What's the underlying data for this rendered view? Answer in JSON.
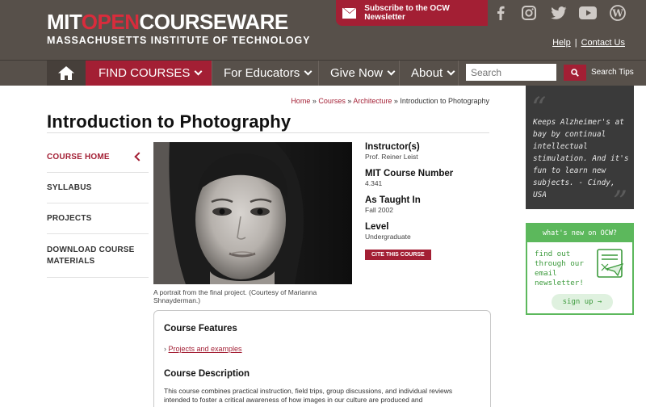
{
  "header": {
    "logo_part1": "MIT",
    "logo_part2": "OPEN",
    "logo_part3": "COURSEWARE",
    "logo_sub": "MASSACHUSETTS INSTITUTE OF TECHNOLOGY",
    "newsletter_label": "Subscribe to the OCW Newsletter",
    "social": [
      "facebook-icon",
      "instagram-icon",
      "twitter-icon",
      "youtube-icon",
      "wordpress-icon"
    ],
    "help_label": "Help",
    "separator": "|",
    "contact_label": "Contact Us",
    "colors": {
      "bar": "#57504a",
      "accent": "#a31f34"
    }
  },
  "nav": {
    "find_courses": "FIND COURSES",
    "for_educators": "For Educators",
    "give_now": "Give Now",
    "about": "About",
    "search_placeholder": "Search",
    "search_tips": "Search Tips"
  },
  "breadcrumb": {
    "home": "Home",
    "courses": "Courses",
    "architecture": "Architecture",
    "current": "Introduction to Photography",
    "sep": " » "
  },
  "page": {
    "title": "Introduction to Photography"
  },
  "sidebar": {
    "items": [
      {
        "label": "COURSE HOME",
        "active": true
      },
      {
        "label": "SYLLABUS"
      },
      {
        "label": "PROJECTS"
      },
      {
        "label": "DOWNLOAD COURSE MATERIALS"
      }
    ]
  },
  "image": {
    "caption": "A portrait from the final project. (Courtesy of Marianna Shnayderman.)"
  },
  "course_info": {
    "instructor_label": "Instructor(s)",
    "instructor": "Prof. Reiner Leist",
    "number_label": "MIT Course Number",
    "number": "4.341",
    "taught_label": "As Taught In",
    "taught": "Fall 2002",
    "level_label": "Level",
    "level": "Undergraduate",
    "cite_button": "CITE THIS COURSE"
  },
  "features": {
    "heading": "Course Features",
    "link_prefix": "›",
    "link": "Projects and examples",
    "desc_heading": "Course Description",
    "desc": "This course combines practical instruction, field trips, group discussions, and individual reviews intended to foster a critical awareness of how images in our culture are produced and"
  },
  "promo": {
    "quote": "Keeps Alzheimer's at bay by continual intellectual stimulation. And it's fun to learn new subjects. - Cindy, USA",
    "whatsnew_title": "what's new on OCW?",
    "whatsnew_body": "find out through our email newsletter!",
    "signup": "sign up →",
    "green": "#5cb85c"
  }
}
